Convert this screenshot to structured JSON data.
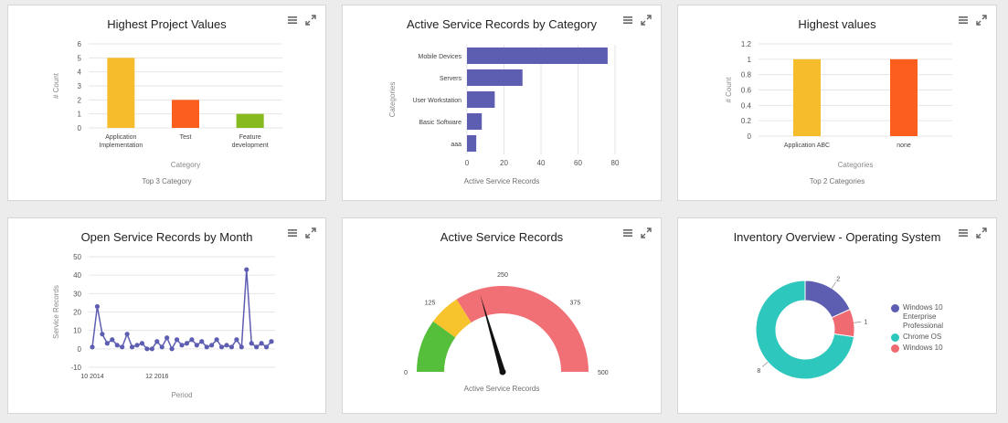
{
  "panels": [
    {
      "title": "Highest Project Values",
      "caption": "Top 3 Category",
      "chart_data": {
        "type": "bar",
        "orientation": "vertical",
        "categories": [
          [
            "Application",
            "Implementation"
          ],
          [
            "Test"
          ],
          [
            "Feature",
            "development"
          ]
        ],
        "values": [
          5,
          2,
          1
        ],
        "colors": [
          "#f5bc2c",
          "#fc5f1d",
          "#86ba1e"
        ],
        "xlabel": "Category",
        "ylabel": "# Count",
        "ylim": [
          0,
          6
        ],
        "ticks": [
          0,
          1,
          2,
          3,
          4,
          5,
          6
        ],
        "grid": true
      }
    },
    {
      "title": "Active Service Records by Category",
      "caption": "Active Service Records",
      "chart_data": {
        "type": "bar",
        "orientation": "horizontal",
        "categories": [
          "Mobile Devices",
          "Servers",
          "User Workstation",
          "Basic Software",
          "aaa"
        ],
        "values": [
          76,
          30,
          15,
          8,
          5
        ],
        "color": "#5d5db2",
        "xlabel": "",
        "ylabel": "Categories",
        "xlim": [
          0,
          80
        ],
        "ticks": [
          0,
          20,
          40,
          60,
          80
        ],
        "grid": true
      }
    },
    {
      "title": "Highest values",
      "caption": "Top 2 Categories",
      "chart_data": {
        "type": "bar",
        "orientation": "vertical",
        "categories": [
          [
            "Application ABC"
          ],
          [
            "none"
          ]
        ],
        "values": [
          1,
          1
        ],
        "colors": [
          "#f5bc2c",
          "#fc5f1d"
        ],
        "xlabel": "Categories",
        "ylabel": "# Count",
        "ylim": [
          0,
          1.2
        ],
        "ticks": [
          0,
          0.2,
          0.4,
          0.6,
          0.8,
          1,
          1.2
        ],
        "grid": true
      }
    },
    {
      "title": "Open Service Records by Month",
      "caption": "",
      "chart_data": {
        "type": "line",
        "x_tick_labels": [
          {
            "index": 0,
            "label": "10 2014"
          },
          {
            "index": 13,
            "label": "12 2016"
          }
        ],
        "values": [
          1,
          23,
          8,
          3,
          5,
          2,
          1,
          8,
          1,
          2,
          3,
          0,
          0,
          4,
          1,
          6,
          0,
          5,
          2,
          3,
          5,
          2,
          4,
          1,
          2,
          5,
          1,
          2,
          1,
          5,
          1,
          43,
          3,
          1,
          3,
          1,
          4
        ],
        "color": "#5d5db2",
        "xlabel": "Period",
        "ylabel": "Service Records",
        "ylim": [
          -10,
          50
        ],
        "ticks": [
          -10,
          0,
          10,
          20,
          30,
          40,
          50
        ],
        "grid": true
      }
    },
    {
      "title": "Active Service Records",
      "caption": "Active Service Records",
      "chart_data": {
        "type": "gauge",
        "min": 0,
        "max": 500,
        "value": 205,
        "tick_labels": [
          0,
          125,
          250,
          375,
          500
        ],
        "bands": [
          {
            "from": 0,
            "to": 100,
            "color": "#55bf3b"
          },
          {
            "from": 100,
            "to": 160,
            "color": "#f8c42d"
          },
          {
            "from": 160,
            "to": 500,
            "color": "#f07075"
          }
        ],
        "needle_color": "#111111"
      }
    },
    {
      "title": "Inventory Overview - Operating System",
      "caption": "",
      "chart_data": {
        "type": "pie",
        "donut": true,
        "slices": [
          {
            "name": "Windows 10 Enterprise Professional",
            "value": 2,
            "color": "#5d5db2"
          },
          {
            "name": "Windows 10",
            "value": 1,
            "color": "#f06a72"
          },
          {
            "name": "Chrome OS",
            "value": 8,
            "color": "#2ec7bd"
          }
        ],
        "legend_order": [
          {
            "name": "Windows 10 Enterprise Professional",
            "color": "#5d5db2"
          },
          {
            "name": "Chrome OS",
            "color": "#2ec7bd"
          },
          {
            "name": "Windows 10",
            "color": "#f06a72"
          }
        ]
      }
    }
  ]
}
